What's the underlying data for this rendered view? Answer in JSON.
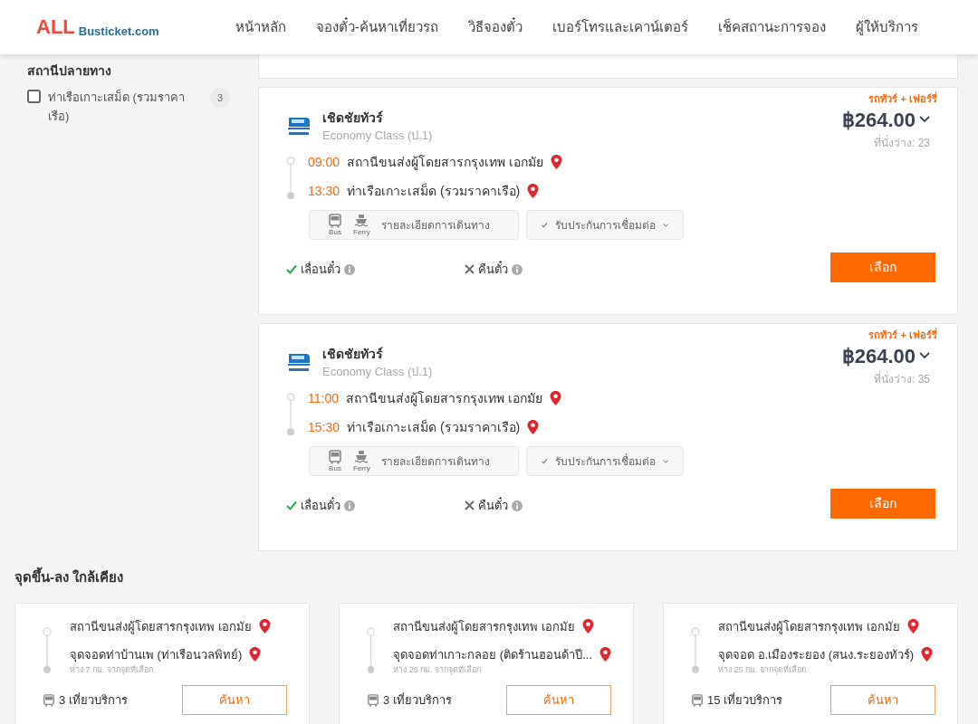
{
  "logo": {
    "main": "ALL",
    "sub": "Busticket.com"
  },
  "nav": [
    "หน้าหลัก",
    "จองตั๋ว-ค้นหาเที่ยวรถ",
    "วิธีจองตั๋ว",
    "เบอร์โทรและเคาน์เตอร์",
    "เช็คสถานะการจอง",
    "ผู้ให้บริการ"
  ],
  "sidebar": {
    "title": "สถานีปลายทาง",
    "options": [
      {
        "label": "ท่าเรือเกาะเสม็ด (รวมราคาเรือ)",
        "count": "3",
        "checked": false
      }
    ]
  },
  "trips": [
    {
      "tag": "รถทัวร์ + เฟอร์รี่",
      "operator": "เชิดชัยทัวร์",
      "class": "Economy Class (ป.1)",
      "price": "฿264.00",
      "seats": "ที่นั่งว่าง: 23",
      "stops": [
        {
          "time": "09:00",
          "place": "สถานีขนส่งผู้โดยสารกรุงเทพ เอกมัย"
        },
        {
          "time": "13:30",
          "place": "ท่าเรือเกาะเสม็ด (รวมราคาเรือ)"
        }
      ],
      "modes": [
        "Bus",
        "Ferry"
      ],
      "details_label": "รายละเอียดการเดินทาง",
      "guarantee_label": "รับประกันการเชื่อมต่อ",
      "policies": [
        {
          "label": "เลื่อนตั๋ว",
          "allowed": true
        },
        {
          "label": "คืนตั๋ว",
          "allowed": false
        }
      ],
      "button": "เลือก"
    },
    {
      "tag": "รถทัวร์ + เฟอร์รี่",
      "operator": "เชิดชัยทัวร์",
      "class": "Economy Class (ป.1)",
      "price": "฿264.00",
      "seats": "ที่นั่งว่าง: 35",
      "stops": [
        {
          "time": "11:00",
          "place": "สถานีขนส่งผู้โดยสารกรุงเทพ เอกมัย"
        },
        {
          "time": "15:30",
          "place": "ท่าเรือเกาะเสม็ด (รวมราคาเรือ)"
        }
      ],
      "modes": [
        "Bus",
        "Ferry"
      ],
      "details_label": "รายละเอียดการเดินทาง",
      "guarantee_label": "รับประกันการเชื่อมต่อ",
      "policies": [
        {
          "label": "เลื่อนตั๋ว",
          "allowed": true
        },
        {
          "label": "คืนตั๋ว",
          "allowed": false
        }
      ],
      "button": "เลือก"
    }
  ],
  "nearby": {
    "title": "จุดขึ้น-ลง ใกล้เคียง",
    "cards": [
      {
        "from": "สถานีขนส่งผู้โดยสารกรุงเทพ เอกมัย",
        "to": "จุดจอดท่าบ้านเพ (ท่าเรือนวลพิทย์)",
        "distance": "ห่าง 7 กม. จากจุดที่เลือก",
        "trips": "3 เที่ยวบริการ",
        "button": "ค้นหา"
      },
      {
        "from": "สถานีขนส่งผู้โดยสารกรุงเทพ เอกมัย",
        "to": "จุดจอดท่าเกาะกลอย (ติดร้านฮอนด้าปี...",
        "distance": "ห่าง 25 กม. จากจุดที่เลือก",
        "trips": "3 เที่ยวบริการ",
        "button": "ค้นหา"
      },
      {
        "from": "สถานีขนส่งผู้โดยสารกรุงเทพ เอกมัย",
        "to": "จุดจอด อ.เมืองระยอง (สนง.ระยองทัวร์)",
        "distance": "ห่าง 25 กม. จากจุดที่เลือก",
        "trips": "15 เที่ยวบริการ",
        "button": "ค้นหา"
      }
    ]
  }
}
